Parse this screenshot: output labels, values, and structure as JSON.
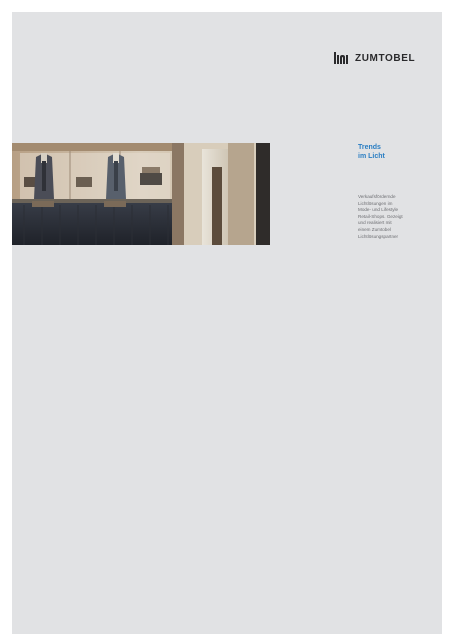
{
  "brand": {
    "name": "ZUMTOBEL",
    "mark_icon": "zumtobel-logo-mark-icon",
    "color": "#2a2a2c"
  },
  "cover": {
    "heading_lines": [
      "Trends",
      "im Licht"
    ],
    "heading_color": "#2a7ec3",
    "body_lines": [
      "Verkaufsfördernde",
      "Lichtlösungen im",
      "Mode- und Lifestyle",
      "Retail-Shops. Gezeigt",
      "und realisiert mit",
      "einem Zumtobel",
      "Lichtlösungspartner"
    ],
    "body_color": "#6d6e72",
    "background_color": "#e1e2e4"
  }
}
